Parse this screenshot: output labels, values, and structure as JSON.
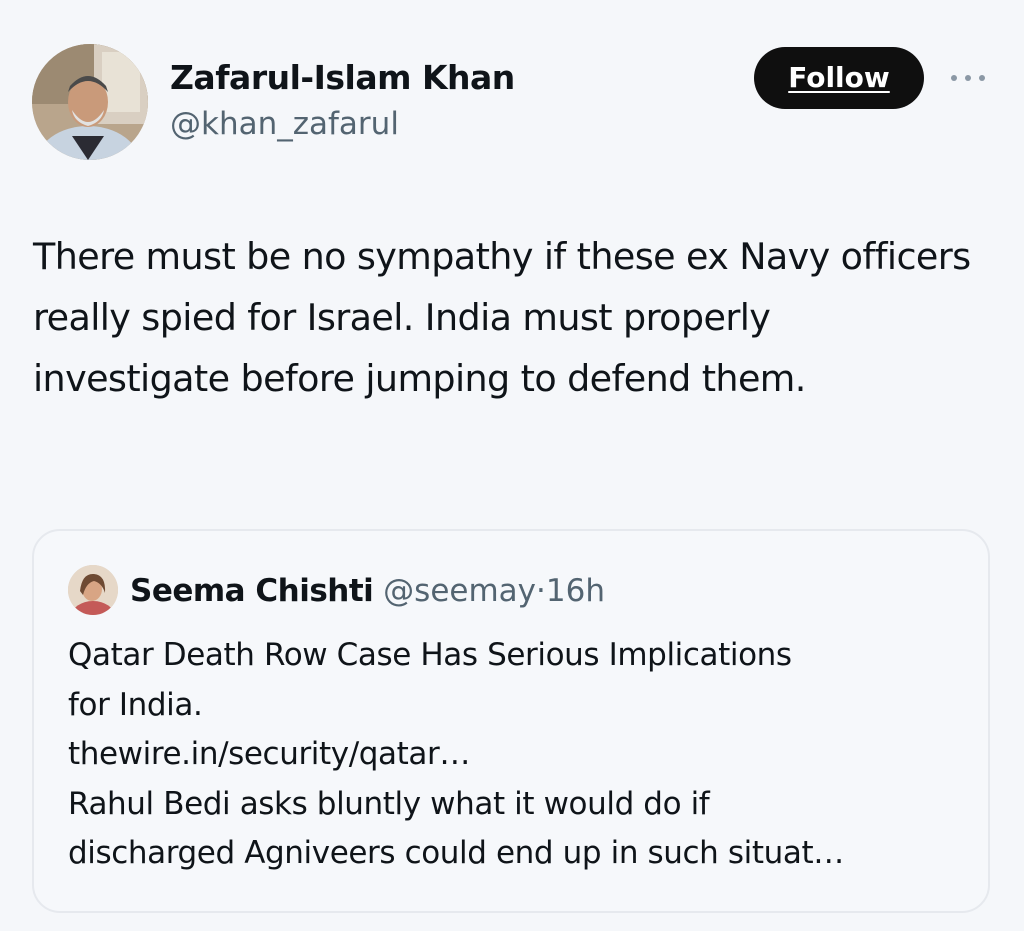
{
  "tweet": {
    "author": {
      "name": "Zafarul-Islam Khan",
      "handle": "@khan_zafarul",
      "avatar_icon": "profile-photo-man"
    },
    "follow_label": "Follow",
    "more_icon": "ellipsis-icon",
    "text": "There must be no sympathy if these ex Navy officers really spied for Israel. India must properly investigate before jumping to defend them."
  },
  "quote": {
    "author": {
      "name": "Seema Chishti",
      "handle": "@seemay",
      "separator": "·",
      "time": "16h",
      "avatar_icon": "profile-photo-woman"
    },
    "lines": [
      "Qatar Death Row Case Has Serious Implications",
      "for India.",
      "thewire.in/security/qatar…",
      "Rahul Bedi asks bluntly what it would do if",
      "discharged Agniveers could end up in such situat…"
    ]
  },
  "colors": {
    "background": "#f5f7fa",
    "primary_text": "#0f1419",
    "secondary_text": "#536471",
    "follow_button": "#0f0f0f",
    "card_border": "#e6e9ee"
  }
}
